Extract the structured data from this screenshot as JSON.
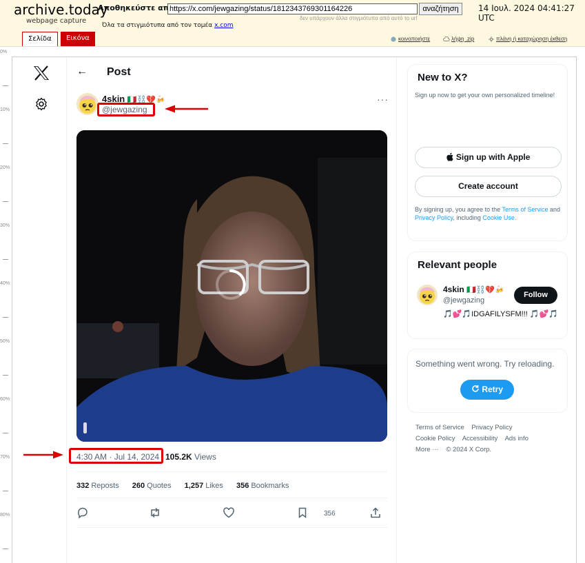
{
  "archive": {
    "logo_title": "archive.today",
    "logo_subtitle": "webpage capture",
    "save_from_label": "Αποθηκεύστε από",
    "url_value": "https://x.com/jewgazing/status/1812343769301164226",
    "search_button": "αναζήτηση",
    "capture_date": "14 Ιουλ. 2024 04:41:27 UTC",
    "no_snapshots_text": "δεν υπάρχουν άλλα στιγμιότυπα από αυτό το url",
    "all_snapshots_text": "Όλα τα στιγμιότυπα  από τον τομέα",
    "domain_link": "x.com",
    "tab_page": "Σελίδα",
    "tab_image": "Εικόνα",
    "share_label": "κοινοποιήστε",
    "download_label": "λήψη .zip",
    "report_label": "πλάνη ή καταχώρηση έκθεση",
    "ruler_labels": [
      "0%",
      "10%",
      "20%",
      "30%",
      "40%",
      "50%",
      "60%",
      "70%",
      "80%",
      "90%"
    ]
  },
  "post": {
    "header_title": "Post",
    "display_name": "4skin",
    "name_emojis": "🇮🇹⛓️💔🍻",
    "handle": "@jewgazing",
    "more": "···",
    "timestamp": "4:30 AM · Jul 14, 2024",
    "views_count": "105.2K",
    "views_label": "Views",
    "reposts_count": "332",
    "reposts_label": "Reposts",
    "quotes_count": "260",
    "quotes_label": "Quotes",
    "likes_count": "1,257",
    "likes_label": "Likes",
    "bookmarks_count": "356",
    "bookmarks_label": "Bookmarks",
    "bookmark_action_count": "356"
  },
  "sidebar": {
    "new_title": "New to X?",
    "new_desc": "Sign up now to get your own personalized timeline!",
    "apple_button": "Sign up with Apple",
    "create_button": "Create account",
    "terms_prefix": "By signing up, you agree to the",
    "terms_link": "Terms of Service",
    "and_text": "and",
    "privacy_link": "Privacy Policy",
    "including_text": ", including",
    "cookie_link": "Cookie Use",
    "relevant_title": "Relevant people",
    "rp_name": "4skin",
    "rp_emojis": "🇮🇹⛓️💔🍻",
    "rp_handle": "@jewgazing",
    "rp_bio": "🎵💕🎵IDGAFILYSFM!!! 🎵💕🎵",
    "follow_button": "Follow",
    "error_text": "Something went wrong. Try reloading.",
    "retry_button": "Retry",
    "footer_links": [
      "Terms of Service",
      "Privacy Policy",
      "Cookie Policy",
      "Accessibility",
      "Ads info",
      "More ···",
      "© 2024 X Corp."
    ]
  },
  "colors": {
    "accent": "#1d9bf0",
    "annotation": "#dd0000",
    "archive_bg": "#fff8e0"
  }
}
